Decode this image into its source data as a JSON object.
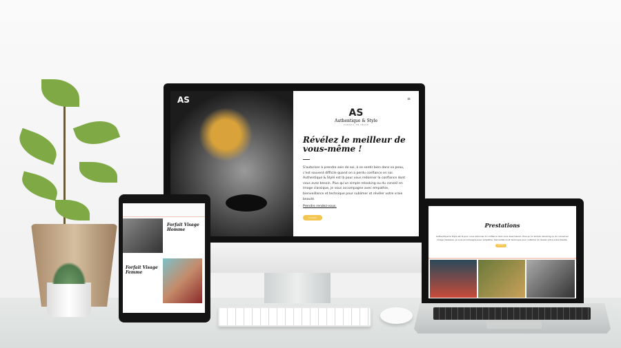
{
  "monitor_site": {
    "logo_mark": "AS",
    "brand": "Authentique & Style",
    "tagline": "CONSEIL EN IMAGE",
    "menu_icon": "hamburger-icon",
    "headline": "Révélez le meilleur de vous-même !",
    "paragraph": "S'autoriser à prendre soin de soi, à se sentir bien dans sa peau, c'est souvent difficile quand on a perdu confiance en soi. Authentique & Stylé est là pour vous redonner la confiance dont vous avez besoin. Plus qu'un simple relooking ou du conseil en image classique, je vous accompagne avec empathie, bienveillance et technique pour sublimer et révéler votre vraie beauté.",
    "cta_link": "Prendre rendez-vous.",
    "button": "Contact"
  },
  "tablet_site": {
    "section1_title": "Forfait Visage Homme",
    "section2_title": "Forfait Visage Femme"
  },
  "laptop_site": {
    "title": "Prestations",
    "paragraph": "Authentique & Stylé est là pour vous redonner la confiance dont vous avez besoin. Plus qu'un simple relooking ou du conseil en image classique, je vous accompagne avec empathie, bienveillance et technique pour sublimer et révéler votre vraie beauté.",
    "button": "Contact"
  },
  "colors": {
    "accent": "#f3c652",
    "gold": "#e0a82e"
  }
}
